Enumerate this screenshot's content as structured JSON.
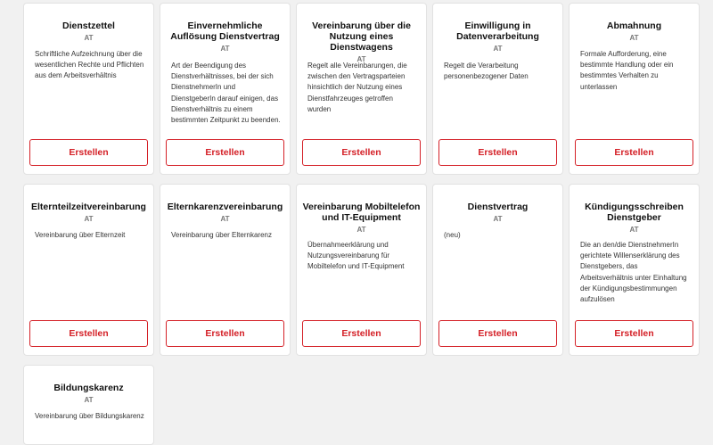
{
  "accent_color": "#d42027",
  "cards": [
    {
      "title": "Dienstzettel",
      "region": "AT",
      "description": "Schriftliche Aufzeichnung über die wesentlichen Rechte und Pflichten aus dem Arbeitsverhältnis",
      "button": "Erstellen"
    },
    {
      "title": "Einvernehmliche Auflösung Dienstvertrag",
      "region": "AT",
      "description": "Art der Beendigung des Dienstverhältnisses, bei der sich DienstnehmerIn und DienstgeberIn darauf einigen, das Dienstverhältnis zu einem bestimmten Zeitpunkt zu beenden.",
      "button": "Erstellen"
    },
    {
      "title": "Vereinbarung über die Nutzung eines Dienstwagens",
      "region": "AT",
      "description": "Regelt alle Vereinbarungen, die zwischen den Vertragsparteien hinsichtlich der Nutzung eines Dienstfahrzeuges getroffen wurden",
      "button": "Erstellen"
    },
    {
      "title": "Einwilligung in Datenverarbeitung",
      "region": "AT",
      "description": "Regelt die Verarbeitung personenbezogener Daten",
      "button": "Erstellen"
    },
    {
      "title": "Abmahnung",
      "region": "AT",
      "description": "Formale Aufforderung, eine bestimmte Handlung oder ein bestimmtes Verhalten zu unterlassen",
      "button": "Erstellen"
    },
    {
      "title": "Elternteilzeitvereinbarung",
      "region": "AT",
      "description": "Vereinbarung über Elternzeit",
      "button": "Erstellen"
    },
    {
      "title": "Elternkarenzvereinbarung",
      "region": "AT",
      "description": "Vereinbarung über Elternkarenz",
      "button": "Erstellen"
    },
    {
      "title": "Vereinbarung Mobiltelefon und IT-Equipment",
      "region": "AT",
      "description": "Übernahmeerklärung und Nutzungsvereinbarung für Mobiltelefon und IT-Equipment",
      "button": "Erstellen"
    },
    {
      "title": "Dienstvertrag",
      "region": "AT",
      "description": "(neu)",
      "button": "Erstellen"
    },
    {
      "title": "Kündigungsschreiben Dienstgeber",
      "region": "AT",
      "description": "Die an den/die DienstnehmerIn gerichtete Willenserklärung des Dienstgebers, das Arbeitsverhältnis unter Einhaltung der Kündigungsbestimmungen aufzulösen",
      "button": "Erstellen"
    },
    {
      "title": "Bildungskarenz",
      "region": "AT",
      "description": "Vereinbarung über Bildungskarenz",
      "button": "Erstellen"
    }
  ]
}
